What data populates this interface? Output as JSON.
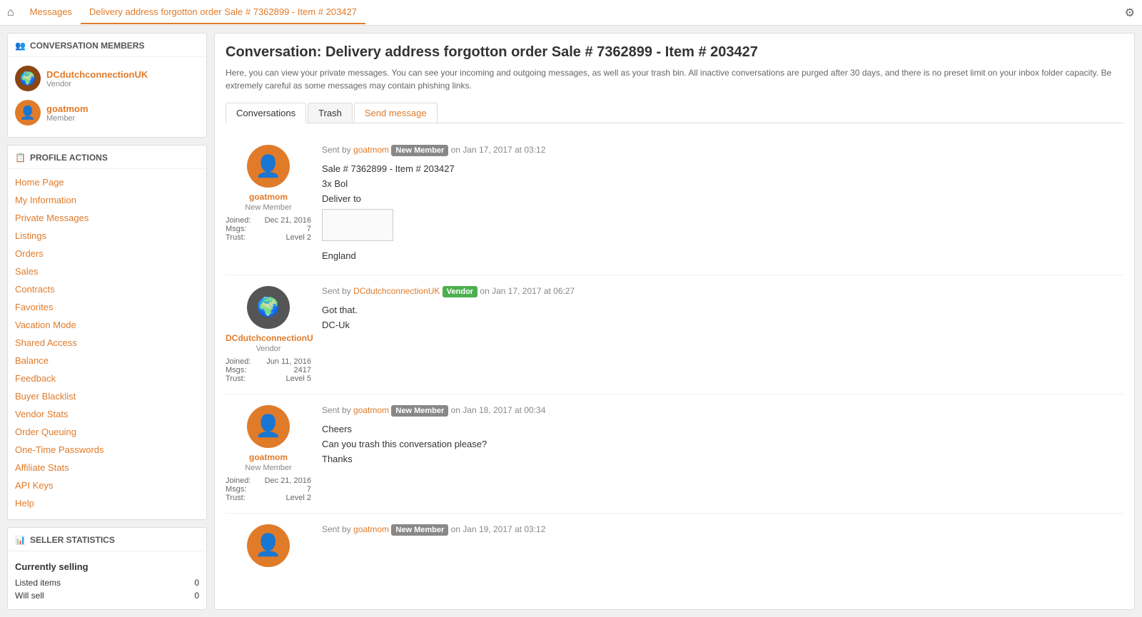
{
  "topnav": {
    "home_icon": "⌂",
    "tabs": [
      {
        "label": "Messages",
        "active": false
      },
      {
        "label": "Delivery address forgotton order Sale # 7362899 - Item # 203427",
        "active": true
      }
    ],
    "settings_icon": "⚙"
  },
  "sidebar": {
    "conversation_members_header": "CONVERSATION MEMBERS",
    "members": [
      {
        "name": "DCdutchconnectionUK",
        "role": "Vendor",
        "type": "vendor"
      },
      {
        "name": "goatmom",
        "role": "Member",
        "type": "member"
      }
    ],
    "profile_actions_header": "PROFILE ACTIONS",
    "profile_links": [
      "Home Page",
      "My Information",
      "Private Messages",
      "Listings",
      "Orders",
      "Sales",
      "Contracts",
      "Favorites",
      "Vacation Mode",
      "Shared Access",
      "Balance",
      "Feedback",
      "Buyer Blacklist",
      "Vendor Stats",
      "Order Queuing",
      "One-Time Passwords",
      "Affiliate Stats",
      "API Keys",
      "Help"
    ],
    "seller_stats_header": "SELLER STATISTICS",
    "seller_stats_subtitle": "Currently selling",
    "seller_stats_rows": [
      {
        "label": "Listed items",
        "value": "0"
      },
      {
        "label": "Will sell",
        "value": "0"
      }
    ]
  },
  "main": {
    "title": "Conversation: Delivery address forgotton order Sale # 7362899 - Item # 203427",
    "description": "Here, you can view your private messages. You can see your incoming and outgoing messages, as well as your trash bin. All inactive conversations are purged after 30 days, and there is no preset limit on your inbox folder capacity. Be extremely careful as some messages may contain phishing links.",
    "tabs": [
      {
        "label": "Conversations",
        "active": true
      },
      {
        "label": "Trash",
        "active": false
      },
      {
        "label": "Send message",
        "active": false,
        "special": true
      }
    ],
    "messages": [
      {
        "sender_username": "goatmom",
        "sender_badge": "New Member",
        "sender_badge_type": "new-member",
        "sent_date": "Jan 17, 2017 at 03:12",
        "avatar_type": "orange",
        "member_label": "goatmom",
        "member_role": "New Member",
        "joined_label": "Joined:",
        "joined_date": "Dec 21, 2016",
        "msgs_label": "Msgs:",
        "msgs_count": "7",
        "trust_label": "Trust:",
        "trust_value": "Level 2",
        "body_lines": [
          "Sale # 7362899 - Item # 203427",
          "3x Bol",
          "Deliver to",
          "[ADDRESS_BOX]",
          "England"
        ]
      },
      {
        "sender_username": "DCdutchconnectionUK",
        "sender_badge": "Vendor",
        "sender_badge_type": "vendor",
        "sent_date": "Jan 17, 2017 at 06:27",
        "avatar_type": "globe",
        "member_label": "DCdutchconnectionU",
        "member_role": "Vendor",
        "joined_label": "Joined:",
        "joined_date": "Jun 11, 2016",
        "msgs_label": "Msgs:",
        "msgs_count": "2417",
        "trust_label": "Trust:",
        "trust_value": "Level 5",
        "body_lines": [
          "Got that.",
          "DC-Uk"
        ]
      },
      {
        "sender_username": "goatmom",
        "sender_badge": "New Member",
        "sender_badge_type": "new-member",
        "sent_date": "Jan 18, 2017 at 00:34",
        "avatar_type": "orange",
        "member_label": "goatmom",
        "member_role": "New Member",
        "joined_label": "Joined:",
        "joined_date": "Dec 21, 2016",
        "msgs_label": "Msgs:",
        "msgs_count": "7",
        "trust_label": "Trust:",
        "trust_value": "Level 2",
        "body_lines": [
          "Cheers",
          "Can you trash this conversation please?",
          "Thanks"
        ]
      },
      {
        "sender_username": "goatmom",
        "sender_badge": "New Member",
        "sender_badge_type": "new-member",
        "sent_date": "Jan 19, 2017 at 03:12",
        "avatar_type": "orange",
        "member_label": "",
        "member_role": "",
        "joined_label": "",
        "joined_date": "",
        "msgs_label": "",
        "msgs_count": "",
        "trust_label": "",
        "trust_value": "",
        "body_lines": []
      }
    ]
  }
}
